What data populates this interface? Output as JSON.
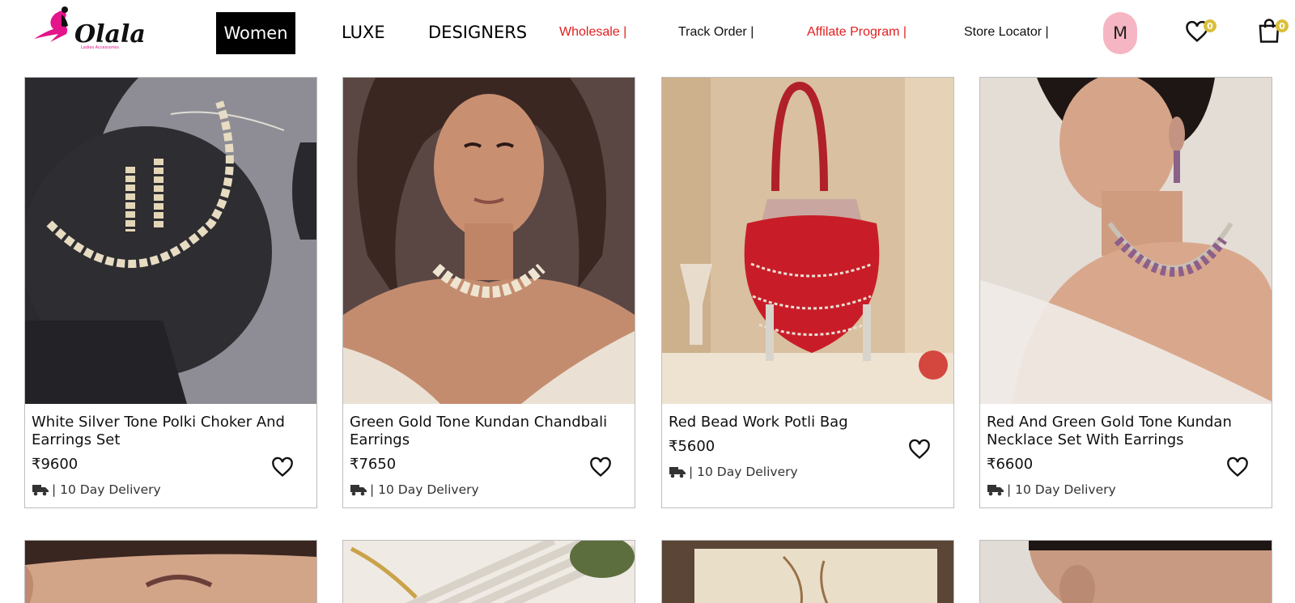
{
  "header": {
    "logo_text": "Olala",
    "logo_tagline": "Ladies Accessories",
    "nav": {
      "women": "Women",
      "luxe": "LUXE",
      "designers": "DESIGNERS",
      "wholesale": "Wholesale |",
      "track_order": "Track Order |",
      "affiliate": "Affilate Program |",
      "store_locator": "Store Locator |"
    },
    "avatar_initial": "M",
    "wishlist_count": "0",
    "cart_count": "0",
    "colors": {
      "accent_red": "#e0201f",
      "avatar_pink": "#f6b5c3",
      "badge_gold": "#d9c03a"
    }
  },
  "products": [
    {
      "title": "White Silver Tone Polki Choker And Earrings Set",
      "price": "₹9600",
      "delivery": "| 10 Day Delivery"
    },
    {
      "title": "Green Gold Tone Kundan Chandbali Earrings",
      "price": "₹7650",
      "delivery": "| 10 Day Delivery"
    },
    {
      "title": "Red Bead Work Potli Bag",
      "price": "₹5600",
      "delivery": "| 10 Day Delivery"
    },
    {
      "title": "Red And Green Gold Tone Kundan Necklace Set With Earrings",
      "price": "₹6600",
      "delivery": "| 10 Day Delivery"
    }
  ],
  "icons": {
    "wishlist": "heart-icon",
    "cart": "shopping-bag-icon",
    "delivery": "delivery-truck-icon"
  }
}
